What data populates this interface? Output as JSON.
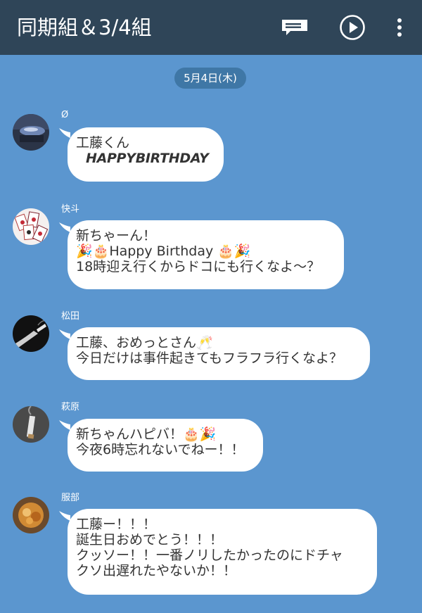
{
  "header": {
    "title": "同期組＆3/4組",
    "icons": [
      "note-icon",
      "play-icon",
      "more-vert-icon"
    ]
  },
  "date_separator": "5月4日(木)",
  "messages": [
    {
      "sender": "Ø",
      "lines": [
        "工藤くん",
        "HAPPYBIRTHDAY"
      ]
    },
    {
      "sender": "快斗",
      "lines": [
        "新ちゃーん！",
        "🎉🎂Happy Birthday 🎂🎉",
        "18時迎え行くからドコにも行くなよ〜？"
      ]
    },
    {
      "sender": "松田",
      "lines": [
        "工藤、おめっとさん🥂",
        "今日だけは事件起きてもフラフラ行くなよ？"
      ]
    },
    {
      "sender": "萩原",
      "lines": [
        "新ちゃんハピバ！🎂🎉",
        "今夜6時忘れないでねー！！"
      ]
    },
    {
      "sender": "服部",
      "lines": [
        "工藤ー！！！",
        "誕生日おめでとう！！！",
        "クッソー！！一番ノリしたかったのにドチャ",
        "クソ出遅れたやないか！！"
      ]
    }
  ],
  "colors": {
    "background": "#5b96cf",
    "topbar": "#2f4558",
    "date_pill": "#3f77a6",
    "bubble": "#ffffff",
    "text": "#333333"
  }
}
